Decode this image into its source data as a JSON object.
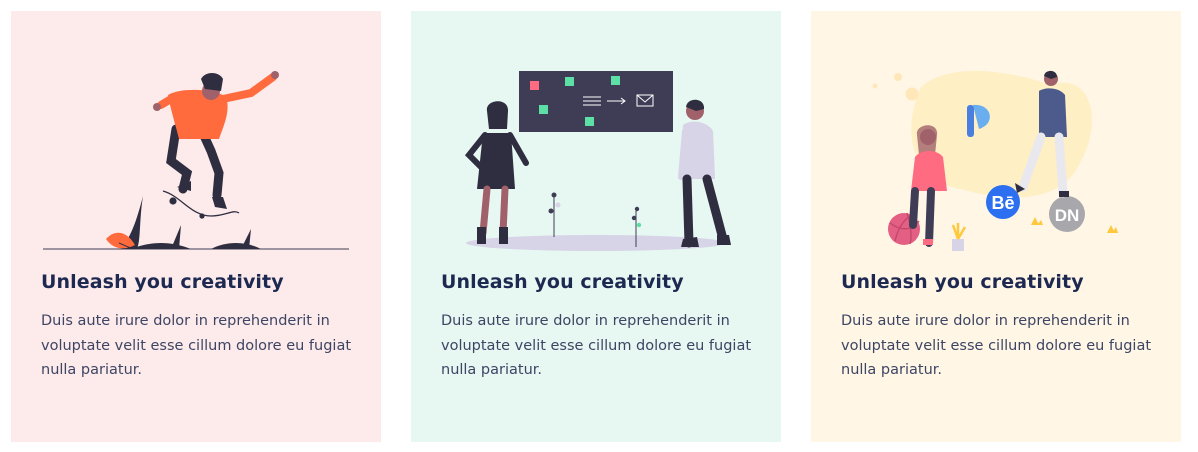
{
  "cards": [
    {
      "title": "Unleash you creativity",
      "text": "Duis aute irure dolor in reprehenderit in voluptate velit esse cillum dolore eu fugiat nulla pariatur.",
      "background": "#fdeaea",
      "illustration": "jumping-person-illustration"
    },
    {
      "title": "Unleash you creativity",
      "text": "Duis aute irure dolor in reprehenderit in voluptate velit esse cillum dolore eu fugiat nulla pariatur.",
      "background": "#e7f7f1",
      "illustration": "people-at-board-illustration"
    },
    {
      "title": "Unleash you creativity",
      "text": "Duis aute irure dolor in reprehenderit in voluptate velit esse cillum dolore eu fugiat nulla pariatur.",
      "background": "#fff6e6",
      "illustration": "social-icons-illustration",
      "badges": [
        "Bē",
        "DN"
      ]
    }
  ],
  "colors": {
    "title": "#1d2951",
    "text": "#3d4564",
    "accent_orange": "#ff6b3d",
    "dark": "#2f2e41"
  }
}
